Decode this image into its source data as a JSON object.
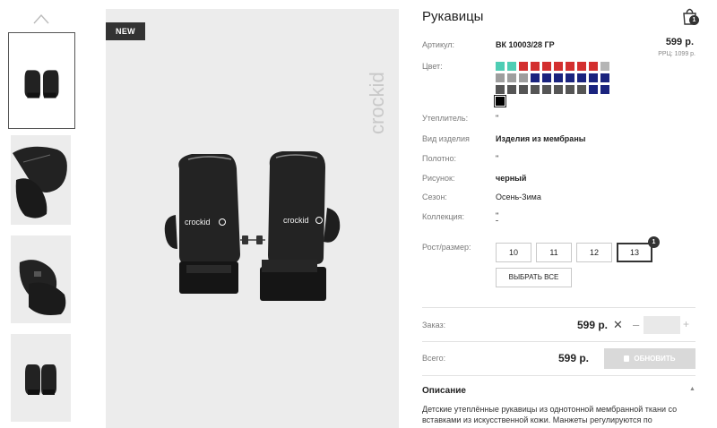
{
  "product": {
    "title": "Рукавицы",
    "badge": "NEW",
    "brand": "crockid",
    "price": "599 р.",
    "rrp": "РРЦ: 1099 р."
  },
  "cart": {
    "count": "1"
  },
  "attributes": [
    {
      "label": "Артикул:",
      "value": "ВК 10003/28 ГР",
      "bold": true
    },
    {
      "label": "Цвет:",
      "value": ""
    },
    {
      "label": "Утеплитель:",
      "value": "\""
    },
    {
      "label": "Вид изделия",
      "value": "Изделия из мембраны",
      "bold": true
    },
    {
      "label": "Полотно:",
      "value": "\""
    },
    {
      "label": "Рисунок:",
      "value": "черный",
      "bold": true
    },
    {
      "label": "Сезон:",
      "value": "Осень-Зима"
    },
    {
      "label": "Коллекция:",
      "value": "\""
    }
  ],
  "colors": {
    "rows": [
      [
        "#4ecdb4",
        "#4ecdb4",
        "#d32f2f",
        "#d32f2f",
        "#d32f2f",
        "#d32f2f",
        "#d32f2f",
        "#d32f2f",
        "#d32f2f",
        "#b5b5b5"
      ],
      [
        "#9e9e9e",
        "#9e9e9e",
        "#9e9e9e",
        "#1a237e",
        "#1a237e",
        "#1a237e",
        "#1a237e",
        "#1a237e",
        "#1a237e",
        "#1a237e"
      ],
      [
        "#555555",
        "#555555",
        "#555555",
        "#555555",
        "#555555",
        "#555555",
        "#555555",
        "#555555",
        "#1a237e",
        "#1a237e"
      ],
      [
        "#000000"
      ]
    ],
    "selected_row": 3,
    "selected_index": 0
  },
  "sizes": {
    "label": "Рост/размер:",
    "options": [
      "10",
      "11",
      "12",
      "13"
    ],
    "selected": "13",
    "selected_count": "1",
    "select_all": "ВЫБРАТЬ ВСЕ"
  },
  "order": {
    "label": "Заказ:",
    "price": "599 р.",
    "remove": "✕",
    "minus": "–",
    "plus": "+",
    "quantity": ""
  },
  "total": {
    "label": "Всего:",
    "price": "599 р.",
    "update_button": "ОБНОВИТЬ"
  },
  "description": {
    "title": "Описание",
    "toggle": "▲",
    "text": "Детские утеплённые рукавицы из однотонной мембранной ткани со вставками из искусственной кожи. Манжеты регулируются по"
  },
  "icons": {
    "thumb_up": "chevron-up-icon",
    "cart": "shopping-bag-icon"
  },
  "theme": {
    "accent": "#333333",
    "background_image": "#ececec"
  }
}
